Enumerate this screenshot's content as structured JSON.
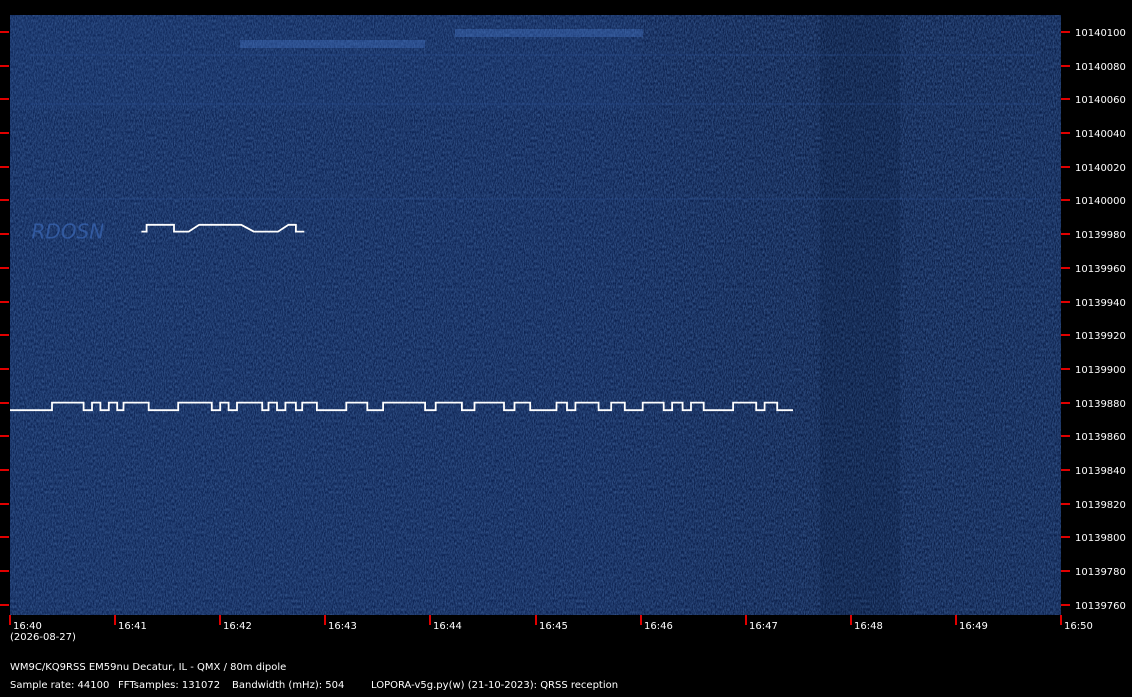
{
  "chart_data": {
    "type": "spectrogram",
    "y_unit": "Hz",
    "yticks": [
      10140100,
      10140080,
      10140060,
      10140040,
      10140020,
      10140000,
      10139980,
      10139960,
      10139940,
      10139920,
      10139900,
      10139880,
      10139860,
      10139840,
      10139820,
      10139800,
      10139780,
      10139760
    ],
    "ylim": [
      10139754,
      10140110
    ],
    "xticks": [
      "16:40",
      "16:41",
      "16:42",
      "16:43",
      "16:44",
      "16:45",
      "16:46",
      "16:47",
      "16:48",
      "16:49",
      "16:50"
    ],
    "xlim_minutes": [
      0,
      10
    ],
    "date_label": "(2026-08-27)",
    "grid": false,
    "colors": {
      "background": "#0c2150",
      "trace": "#ffffff",
      "tick": "#e00000"
    },
    "signals": [
      {
        "base_hz": 10139875.5,
        "shift_hz": 4.5,
        "t_start": 0.0,
        "t_end": 7.45,
        "keying": [
          [
            0,
            0.4,
            0
          ],
          [
            0.4,
            0.7,
            1
          ],
          [
            0.7,
            0.78,
            0
          ],
          [
            0.78,
            0.86,
            1
          ],
          [
            0.86,
            0.94,
            0
          ],
          [
            0.94,
            1.02,
            1
          ],
          [
            1.02,
            1.08,
            0
          ],
          [
            1.08,
            1.32,
            1
          ],
          [
            1.32,
            1.6,
            0
          ],
          [
            1.6,
            1.92,
            1
          ],
          [
            1.92,
            2.0,
            0
          ],
          [
            2.0,
            2.08,
            1
          ],
          [
            2.08,
            2.16,
            0
          ],
          [
            2.16,
            2.4,
            1
          ],
          [
            2.4,
            2.46,
            0
          ],
          [
            2.46,
            2.54,
            1
          ],
          [
            2.54,
            2.62,
            0
          ],
          [
            2.62,
            2.72,
            1
          ],
          [
            2.72,
            2.78,
            0
          ],
          [
            2.78,
            2.92,
            1
          ],
          [
            2.92,
            3.2,
            0
          ],
          [
            3.2,
            3.4,
            1
          ],
          [
            3.4,
            3.55,
            0
          ],
          [
            3.55,
            3.95,
            1
          ],
          [
            3.95,
            4.05,
            0
          ],
          [
            4.05,
            4.3,
            1
          ],
          [
            4.3,
            4.42,
            0
          ],
          [
            4.42,
            4.7,
            1
          ],
          [
            4.7,
            4.8,
            0
          ],
          [
            4.8,
            4.95,
            1
          ],
          [
            4.95,
            5.2,
            0
          ],
          [
            5.2,
            5.3,
            1
          ],
          [
            5.3,
            5.38,
            0
          ],
          [
            5.38,
            5.6,
            1
          ],
          [
            5.6,
            5.72,
            0
          ],
          [
            5.72,
            5.85,
            1
          ],
          [
            5.85,
            6.02,
            0
          ],
          [
            6.02,
            6.22,
            1
          ],
          [
            6.22,
            6.3,
            0
          ],
          [
            6.3,
            6.4,
            1
          ],
          [
            6.4,
            6.48,
            0
          ],
          [
            6.48,
            6.6,
            1
          ],
          [
            6.6,
            6.88,
            0
          ],
          [
            6.88,
            7.1,
            1
          ],
          [
            7.1,
            7.18,
            0
          ],
          [
            7.18,
            7.3,
            1
          ],
          [
            7.3,
            7.45,
            0
          ]
        ]
      },
      {
        "base_hz": 10139981.5,
        "shift_hz": 4.0,
        "t_start": 1.25,
        "t_end": 2.8,
        "keying": [
          [
            1.25,
            1.3,
            0
          ],
          [
            1.3,
            1.38,
            1
          ],
          [
            1.48,
            1.56,
            1
          ],
          [
            1.56,
            1.7,
            0
          ],
          [
            1.8,
            2.2,
            1
          ],
          [
            2.32,
            2.55,
            0
          ],
          [
            2.65,
            2.72,
            1
          ],
          [
            2.72,
            2.8,
            0
          ]
        ]
      }
    ],
    "faint_marks": [
      {
        "text": "RDOSN",
        "minute": 0.3,
        "hz": 10139981,
        "color": "#3a67b5"
      }
    ]
  },
  "footer": {
    "station": "WM9C/KQ9RSS EM59nu Decatur, IL - QMX / 80m dipole",
    "sample_rate": "Sample rate: 44100",
    "fft_samples": "FFTsamples: 131072",
    "bandwidth": "Bandwidth (mHz): 504",
    "software": "LOPORA-v5g.py(w) (21-10-2023): QRSS reception"
  }
}
